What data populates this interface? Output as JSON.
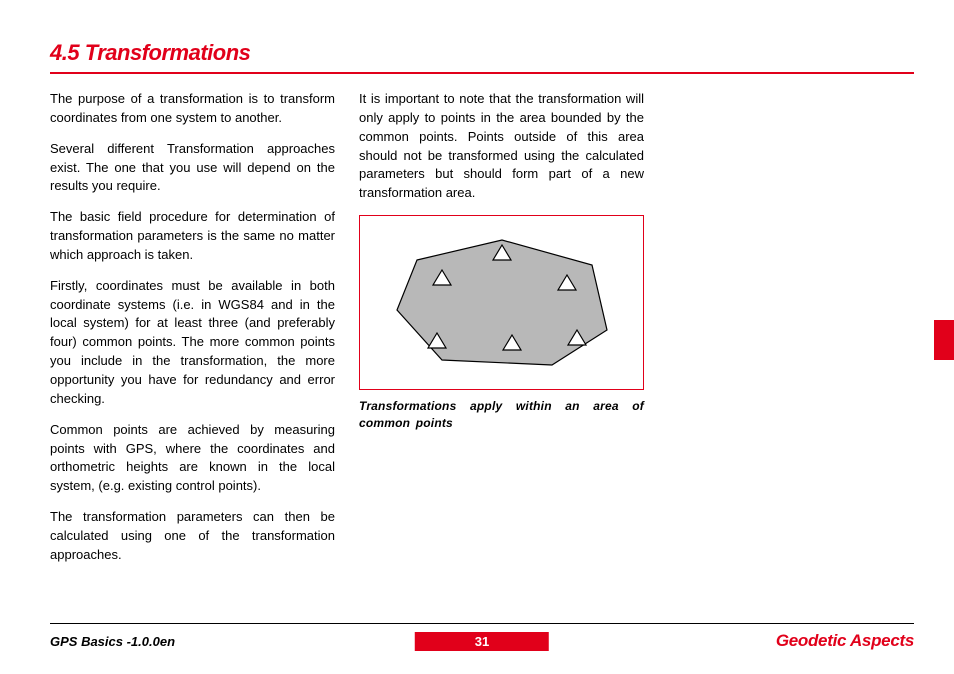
{
  "heading": "4.5 Transformations",
  "col1": {
    "p1": "The purpose of a transformation is to transform coordinates from one system to another.",
    "p2": "Several different Transformation approaches exist. The one that you use will depend on the results you require.",
    "p3": "The basic field procedure for determination of transformation parameters is the same no matter which approach is taken.",
    "p4": "Firstly, coordinates must be available in both coordinate systems (i.e. in WGS84 and in the local system) for at least three (and preferably four) common points. The more common points you include in the transformation, the more opportunity you have for redundancy and error checking.",
    "p5": "Common points are achieved by measuring points with GPS, where the coordinates and orthometric heights are known in the local system, (e.g. existing control points).",
    "p6": "The transformation parameters can then be calculated using one of the transformation approaches."
  },
  "col2": {
    "p1": "It is important to note that the transformation will only apply to points in the area bounded by the common points. Points outside of this area should not be transformed using the calculated parameters but should form part of a new transformation area.",
    "caption": "Transformations apply within an area of common points"
  },
  "footer": {
    "left": "GPS Basics -1.0.0en",
    "page": "31",
    "right": "Geodetic Aspects"
  }
}
